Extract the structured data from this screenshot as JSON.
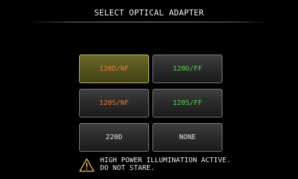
{
  "screen": {
    "title": "SELECT OPTICAL ADAPTER"
  },
  "adapters": [
    {
      "label": "120D/NF",
      "color": "#f07a2e",
      "selected": true
    },
    {
      "label": "120D/FF",
      "color": "#5ad25a",
      "selected": false
    },
    {
      "label": "120S/NF",
      "color": "#f07a2e",
      "selected": false
    },
    {
      "label": "120S/FF",
      "color": "#5ad25a",
      "selected": false
    },
    {
      "label": "220D",
      "color": "#e4e4e4",
      "selected": false
    },
    {
      "label": "NONE",
      "color": "#e4e4e4",
      "selected": false
    }
  ],
  "warning": {
    "icon": "warning-triangle-icon",
    "line1": "HIGH POWER ILLUMINATION ACTIVE.",
    "line2": "DO NOT STARE."
  },
  "colors": {
    "background": "#000000",
    "selected_border": "#c8c24a",
    "selected_fill": "#565620"
  }
}
